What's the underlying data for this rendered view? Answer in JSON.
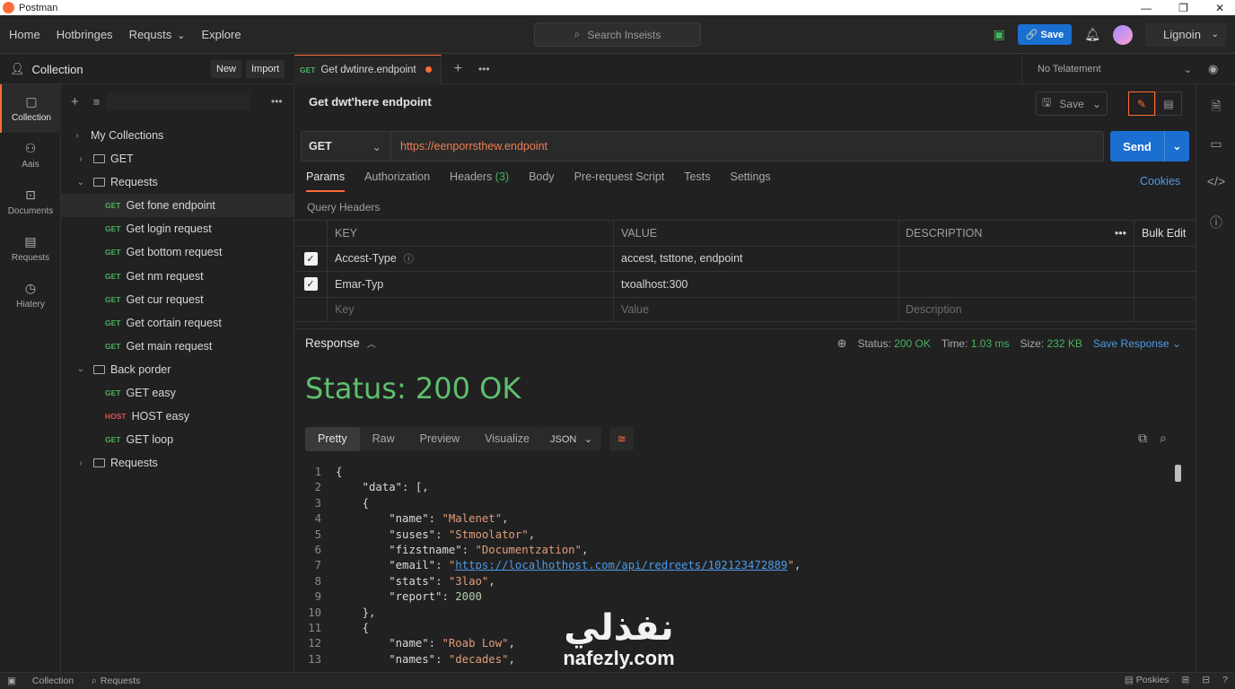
{
  "window": {
    "title": "Postman"
  },
  "nav": {
    "home": "Home",
    "workspaces": "Hotbringes",
    "requests": "Requsts",
    "explore": "Explore"
  },
  "search": {
    "placeholder": "Search Inseists"
  },
  "header": {
    "save": "Save",
    "login": "Lignoin"
  },
  "collection_panel": {
    "title": "Collection",
    "new_label": "New",
    "import_label": "Import"
  },
  "rail": [
    {
      "label": "Collection",
      "icon": "collection-icon"
    },
    {
      "label": "Aais",
      "icon": "apis-icon"
    },
    {
      "label": "Documents",
      "icon": "documents-icon"
    },
    {
      "label": "Requests",
      "icon": "requests-icon"
    },
    {
      "label": "Hiatery",
      "icon": "history-icon"
    }
  ],
  "tree": {
    "root": "My Collections",
    "items": [
      {
        "label": "GET",
        "kind": "folder"
      },
      {
        "label": "Requests",
        "kind": "folder-open"
      },
      {
        "method": "GET",
        "label": "Get fone endpoint"
      },
      {
        "method": "GET",
        "label": "Get login request"
      },
      {
        "method": "GET",
        "label": "Get bottom request"
      },
      {
        "method": "GET",
        "label": "Get nm request"
      },
      {
        "method": "GET",
        "label": "Get cur request"
      },
      {
        "method": "GET",
        "label": "Get cortain request"
      },
      {
        "method": "GET",
        "label": "Get main request"
      },
      {
        "label": "Back porder",
        "kind": "folder-open"
      },
      {
        "method": "GET",
        "label": "GET easy"
      },
      {
        "method": "HOST",
        "label": "HOST easy"
      },
      {
        "method": "GET",
        "label": "GET loop"
      },
      {
        "label": "Requests",
        "kind": "folder"
      }
    ]
  },
  "tab": {
    "method": "GET",
    "name": "Get dwtinre.endpoint"
  },
  "environment": {
    "selected": "No Telatement"
  },
  "request": {
    "title": "Get dwt'here endpoint",
    "save_label": "Save",
    "method": "GET",
    "url": "https://eenporrsthew.endpoint",
    "send_label": "Send"
  },
  "req_tabs": {
    "params": "Params",
    "authorization": "Authorization",
    "headers": "Headers",
    "headers_count": "(3)",
    "body": "Body",
    "prerequest": "Pre-request Script",
    "tests": "Tests",
    "settings": "Settings",
    "cookies": "Cookies"
  },
  "query_headers_label": "Query Headers",
  "kv_table": {
    "columns": {
      "key": "KEY",
      "value": "VALUE",
      "description": "DESCRIPTION",
      "bulk_edit": "Bulk Edit"
    },
    "rows": [
      {
        "key": "Accest-Type",
        "value": "accest, tsttone, endpoint",
        "description": ""
      },
      {
        "key": "Emar-Typ",
        "value": "txoalhost:300",
        "description": ""
      }
    ],
    "placeholders": {
      "key": "Key",
      "value": "Value",
      "description": "Description"
    }
  },
  "response": {
    "title": "Response",
    "status_label": "Status:",
    "status_value": "200 OK",
    "time_label": "Time:",
    "time_value": "1.03 ms",
    "size_label": "Size:",
    "size_value": "232 KB",
    "save_response": "Save Response",
    "big_status": "Status: 200 OK",
    "formats": {
      "pretty": "Pretty",
      "raw": "Raw",
      "preview": "Preview",
      "visualize": "Visualize"
    },
    "lang": "JSON"
  },
  "code_lines": [
    {
      "n": "1",
      "parts": [
        [
          "p",
          "{"
        ]
      ]
    },
    {
      "n": "2",
      "parts": [
        [
          "p",
          "    "
        ],
        [
          "k",
          "\"data\""
        ],
        [
          "p",
          ": [,"
        ]
      ]
    },
    {
      "n": "3",
      "parts": [
        [
          "p",
          "    {"
        ]
      ]
    },
    {
      "n": "4",
      "parts": [
        [
          "p",
          "        "
        ],
        [
          "k",
          "\"name\""
        ],
        [
          "p",
          ": "
        ],
        [
          "s",
          "\"Malenet\""
        ],
        [
          "p",
          ","
        ]
      ]
    },
    {
      "n": "5",
      "parts": [
        [
          "p",
          "        "
        ],
        [
          "k",
          "\"suses\""
        ],
        [
          "p",
          ": "
        ],
        [
          "s",
          "\"Stmoolator\""
        ],
        [
          "p",
          ","
        ]
      ]
    },
    {
      "n": "6",
      "parts": [
        [
          "p",
          "        "
        ],
        [
          "k",
          "\"fizstname\""
        ],
        [
          "p",
          ": "
        ],
        [
          "s",
          "\"Documentzation\""
        ],
        [
          "p",
          ","
        ]
      ]
    },
    {
      "n": "7",
      "parts": [
        [
          "p",
          "        "
        ],
        [
          "k",
          "\"email\""
        ],
        [
          "p",
          ": "
        ],
        [
          "s",
          "\""
        ],
        [
          "l",
          "https://localhothost.com/api/redreets/102123472889"
        ],
        [
          "s",
          "\""
        ],
        [
          "p",
          ","
        ]
      ]
    },
    {
      "n": "8",
      "parts": [
        [
          "p",
          "        "
        ],
        [
          "k",
          "\"stats\""
        ],
        [
          "p",
          ": "
        ],
        [
          "s",
          "\"3lao\""
        ],
        [
          "p",
          ","
        ]
      ]
    },
    {
      "n": "9",
      "parts": [
        [
          "p",
          "        "
        ],
        [
          "k",
          "\"report\""
        ],
        [
          "p",
          ": "
        ],
        [
          "n",
          "2000"
        ]
      ]
    },
    {
      "n": "10",
      "parts": [
        [
          "p",
          "    },"
        ]
      ]
    },
    {
      "n": "11",
      "parts": [
        [
          "p",
          "    {"
        ]
      ]
    },
    {
      "n": "12",
      "parts": [
        [
          "p",
          "        "
        ],
        [
          "k",
          "\"name\""
        ],
        [
          "p",
          ": "
        ],
        [
          "s",
          "\"Roab Low\""
        ],
        [
          "p",
          ","
        ]
      ]
    },
    {
      "n": "13",
      "parts": [
        [
          "p",
          "        "
        ],
        [
          "k",
          "\"names\""
        ],
        [
          "p",
          ": "
        ],
        [
          "s",
          "\"decades\""
        ],
        [
          "p",
          ","
        ]
      ]
    }
  ],
  "watermark": {
    "arabic": "نفذلي",
    "latin": "nafezly.com"
  },
  "statusbar": {
    "collection": "Collection",
    "requests": "Requests",
    "right": "Poskies"
  },
  "colors": {
    "accent": "#ff6c37",
    "primary": "#1a6fd1",
    "success": "#48b35e",
    "background": "#212121"
  }
}
